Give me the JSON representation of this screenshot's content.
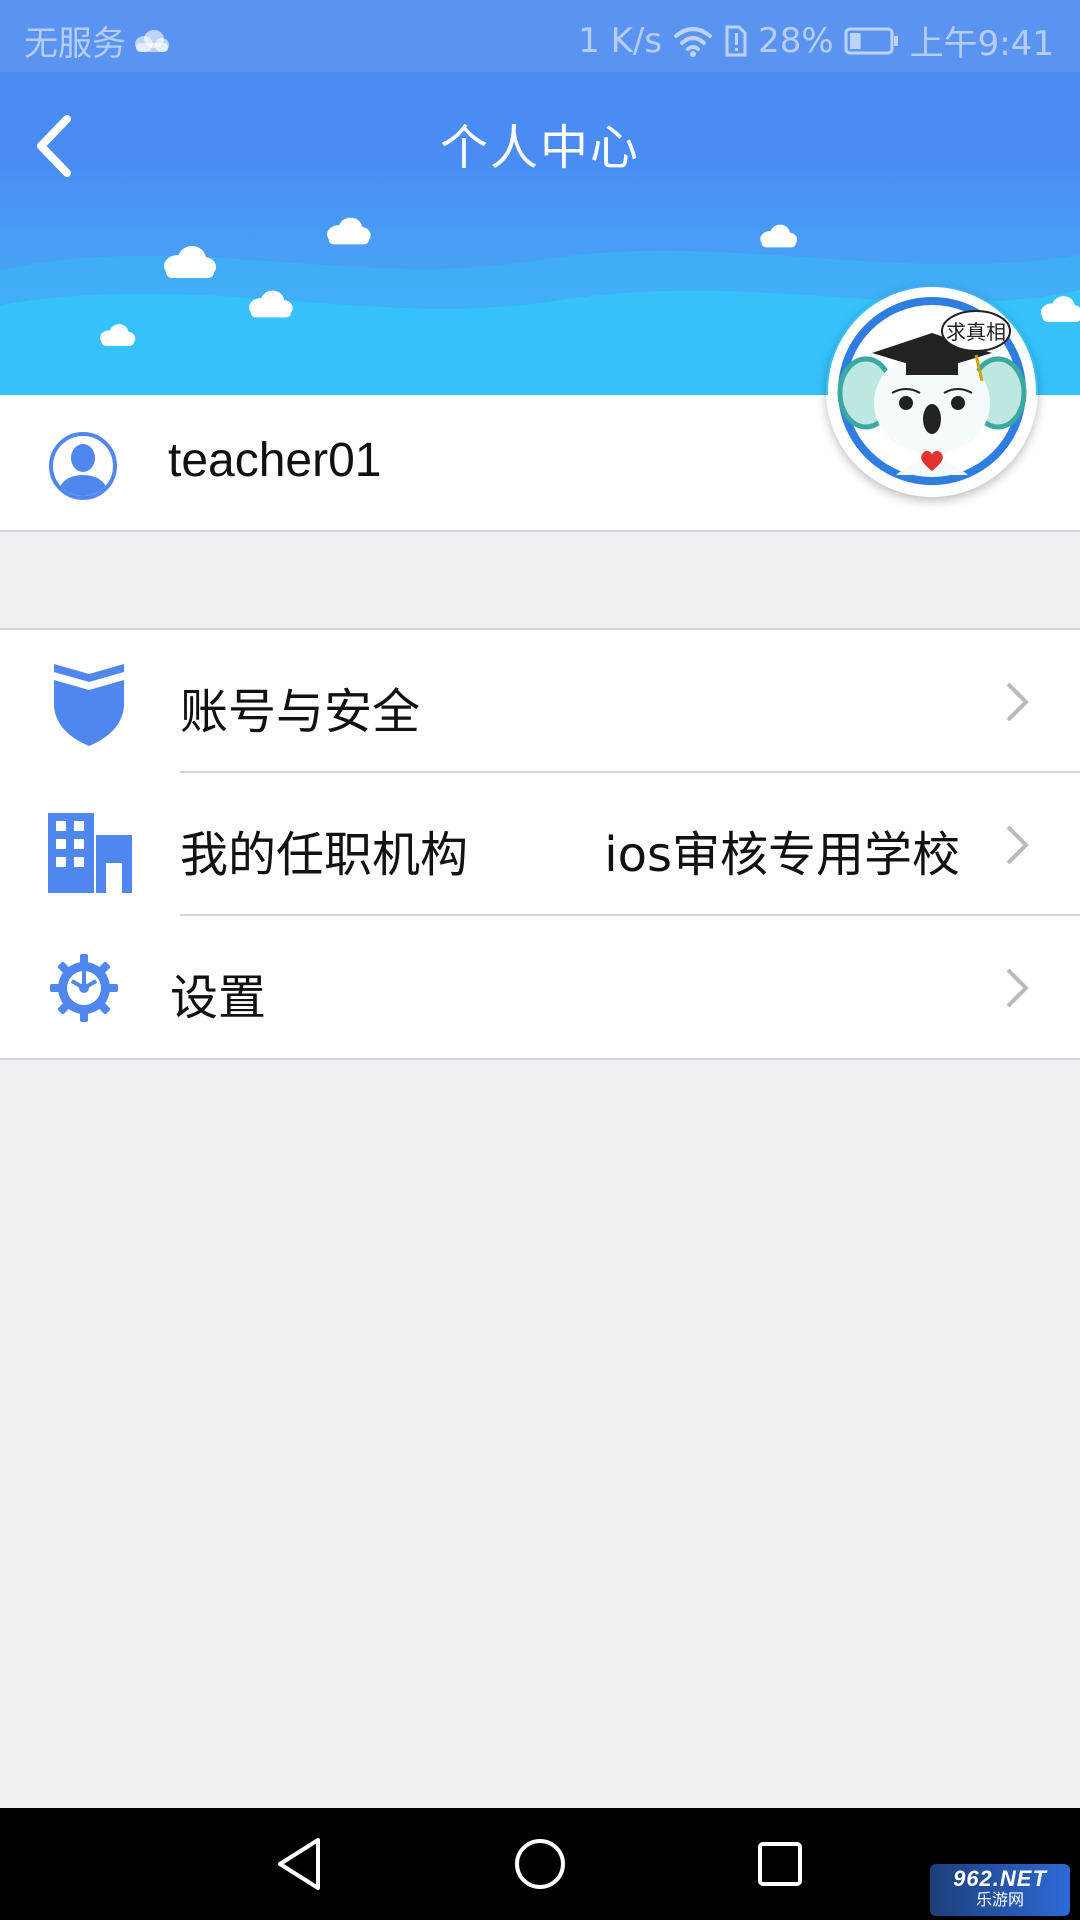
{
  "status_bar": {
    "carrier": "无服务",
    "speed": "1 K/s",
    "battery_percent": "28%",
    "time": "上午9:41",
    "battery_level": 0.28
  },
  "header": {
    "title": "个人中心",
    "mascot_text": "求真相"
  },
  "user": {
    "username": "teacher01"
  },
  "menu": {
    "items": [
      {
        "label": "账号与安全",
        "value": "",
        "icon": "shield-icon"
      },
      {
        "label": "我的任职机构",
        "value": "ios审核专用学校",
        "icon": "building-icon"
      },
      {
        "label": "设置",
        "value": "",
        "icon": "gear-icon"
      }
    ]
  },
  "watermark": {
    "line1": "962.NET",
    "line2": "乐游网"
  },
  "colors": {
    "accent": "#4a8cf4",
    "icon_blue": "#4f87ee",
    "page_bg": "#efeff4"
  }
}
